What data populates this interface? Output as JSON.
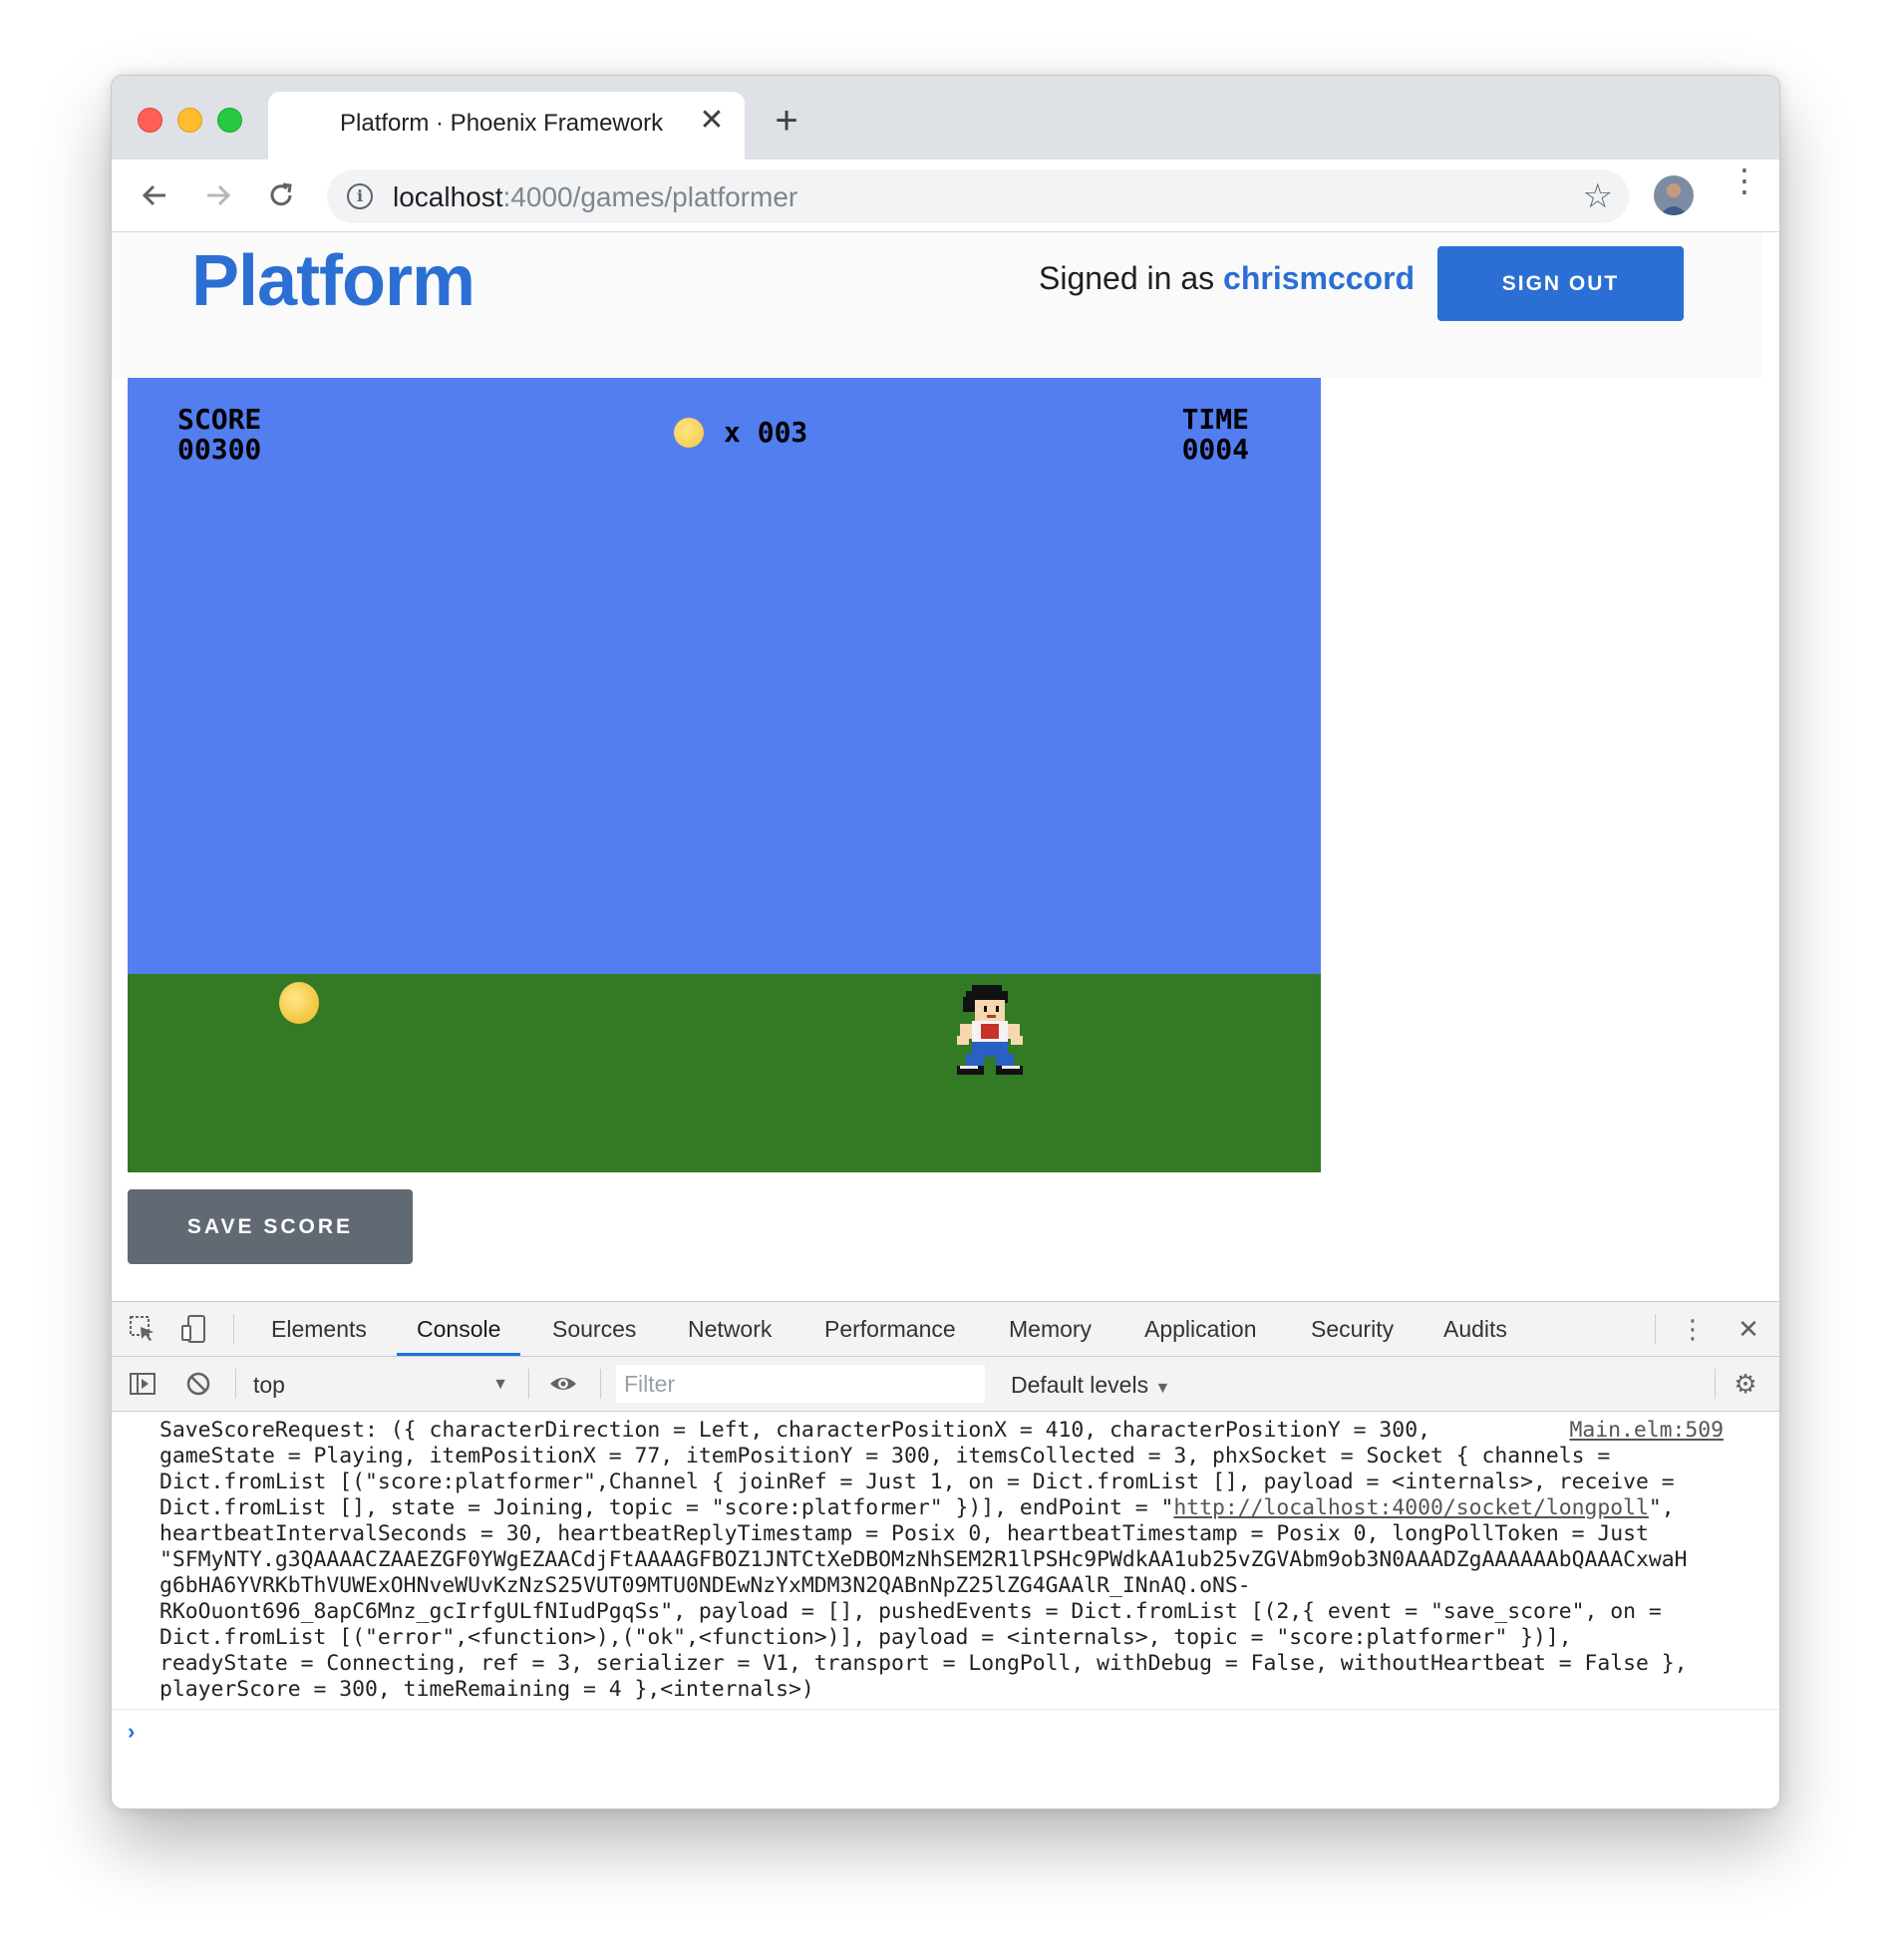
{
  "browser": {
    "tab_title": "Platform · Phoenix Framework",
    "tab_close": "✕",
    "new_tab": "+",
    "url_host": "localhost",
    "url_path": ":4000/games/platformer"
  },
  "header": {
    "logo": "Platform",
    "signed_in_prefix": "Signed in as ",
    "username": "chrismccord",
    "sign_out_label": "SIGN OUT"
  },
  "game": {
    "score_label": "SCORE",
    "score_value": "00300",
    "coins_label": "x 003",
    "time_label": "TIME",
    "time_value": "0004"
  },
  "save_score_label": "SAVE SCORE",
  "devtools": {
    "tabs": [
      "Elements",
      "Console",
      "Sources",
      "Network",
      "Performance",
      "Memory",
      "Application",
      "Security",
      "Audits"
    ],
    "active_tab": "Console",
    "context": "top",
    "filter_placeholder": "Filter",
    "levels": "Default levels",
    "log_source": "Main.elm:509",
    "log_lines": [
      "SaveScoreRequest: ({ characterDirection = Left, characterPositionX = 410, characterPositionY = 300,",
      "gameState = Playing, itemPositionX = 77, itemPositionY = 300, itemsCollected = 3, phxSocket = Socket { channels =",
      "Dict.fromList [(\"score:platformer\",Channel { joinRef = Just 1, on = Dict.fromList [], payload = <internals>, receive =",
      "Dict.fromList [], state = Joining, topic = \"score:platformer\" })], endPoint = \"",
      "heartbeatIntervalSeconds = 30, heartbeatReplyTimestamp = Posix 0, heartbeatTimestamp = Posix 0, longPollToken = Just",
      "\"SFMyNTY.g3QAAAACZAAEZGF0YWgEZAACdjFtAAAAGFBOZ1JNTCtXeDBOMzNhSEM2R1lPSHc9PWdkAA1ub25vZGVAbm9ob3N0AAADZgAAAAAAbQAAACxwaH",
      "g6bHA6YVRKbThVUWExOHNveWUvKzNzS25VUT09MTU0NDEwNzYxMDM3N2QABnNpZ25lZG4GAAlR_INnAQ.oNS-",
      "RKoOuont696_8apC6Mnz_gcIrfgULfNIudPgqSs\", payload = [], pushedEvents = Dict.fromList [(2,{ event = \"save_score\", on =",
      "Dict.fromList [(\"error\",<function>),(\"ok\",<function>)], payload = <internals>, topic = \"score:platformer\" })],",
      "readyState = Connecting, ref = 3, serializer = V1, transport = LongPoll, withDebug = False, withoutHeartbeat = False },",
      "playerScore = 300, timeRemaining = 4 },<internals>)"
    ],
    "log_link": "http://localhost:4000/socket/longpoll",
    "log_line4_suffix": "\",",
    "prompt": "›"
  }
}
